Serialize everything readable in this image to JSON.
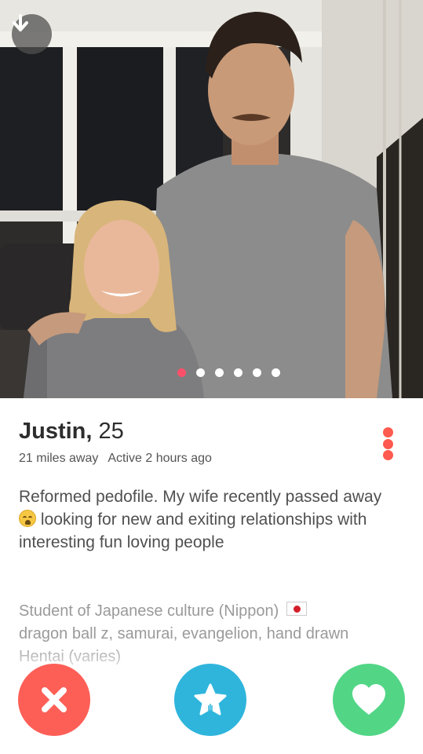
{
  "profile": {
    "name": "Justin,",
    "age": "25",
    "distance": "21 miles away",
    "activity": "Active 2 hours ago",
    "bio_part1": "Reformed pedofile. My wife recently passed away",
    "bio_emoji": "crying-face-emoji",
    "bio_part2": " looking for new and exiting relationships with interesting fun loving people",
    "interests": "Student of Japanese culture (Nippon)",
    "interests_flag": "japan-flag",
    "interests_more": "dragon ball z, samurai, evangelion, hand drawn Hentai (varies)"
  },
  "photos": {
    "count": 6,
    "active_index": 0
  },
  "colors": {
    "accent": "#fd5068",
    "nope": "#fd5f57",
    "super_like": "#2fb5dc",
    "like": "#52d686",
    "menu_dots": "#ff5a4f"
  },
  "icons": {
    "collapse": "arrow-down-icon",
    "menu": "more-vertical-icon",
    "nope": "x-icon",
    "super_like": "star-icon",
    "like": "heart-icon"
  }
}
